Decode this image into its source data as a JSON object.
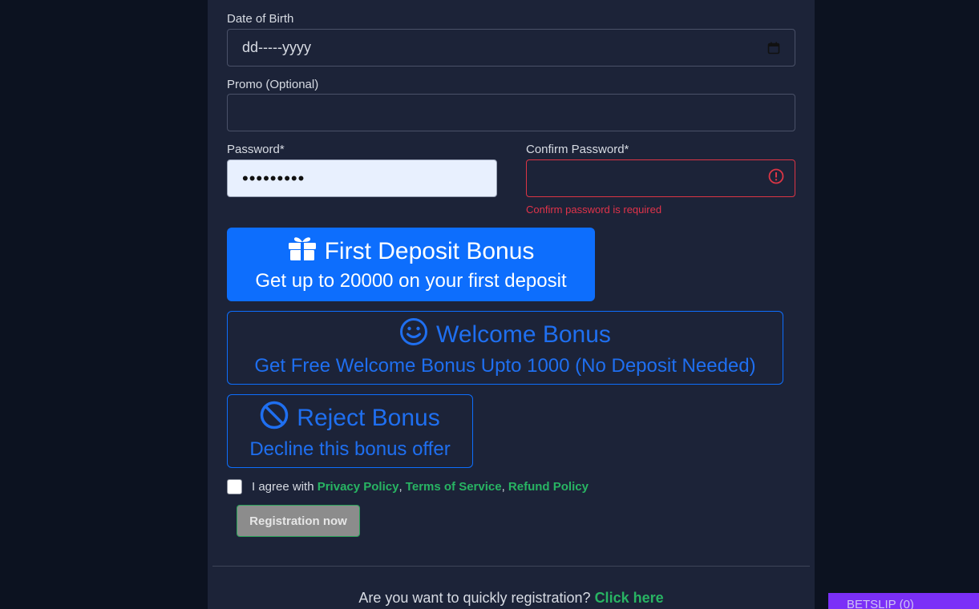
{
  "form": {
    "dob_label": "Date of Birth",
    "dob_placeholder": "dd-----yyyy",
    "promo_label": "Promo (Optional)",
    "promo_value": "",
    "password_label": "Password*",
    "password_value": "•••••••••",
    "confirm_label": "Confirm Password*",
    "confirm_value": "",
    "confirm_error": "Confirm password is required"
  },
  "bonuses": {
    "first": {
      "title": "First Deposit Bonus",
      "subtitle": "Get up to 20000 on your first deposit",
      "icon": "gift-icon",
      "selected": true
    },
    "welcome": {
      "title": "Welcome Bonus",
      "subtitle": "Get Free Welcome Bonus Upto 1000 (No Deposit Needed)",
      "icon": "smile-icon",
      "selected": false
    },
    "reject": {
      "title": "Reject Bonus",
      "subtitle": "Decline this bonus offer",
      "icon": "ban-icon",
      "selected": false
    }
  },
  "agreement": {
    "prefix": "I agree with",
    "privacy": "Privacy Policy",
    "sep1": ",",
    "terms": "Terms of Service",
    "sep2": ",",
    "refund": "Refund Policy",
    "checked": false
  },
  "register_button": "Registration now",
  "quick": {
    "text": "Are you want to quickly registration?",
    "link": "Click here"
  },
  "betslip": "BETSLIP (0)",
  "colors": {
    "page_bg": "#0c1220",
    "panel_bg": "#1c2338",
    "primary": "#0d6efd",
    "link_green": "#28b463",
    "error": "#dc3545",
    "betslip": "#7b2ff7"
  }
}
